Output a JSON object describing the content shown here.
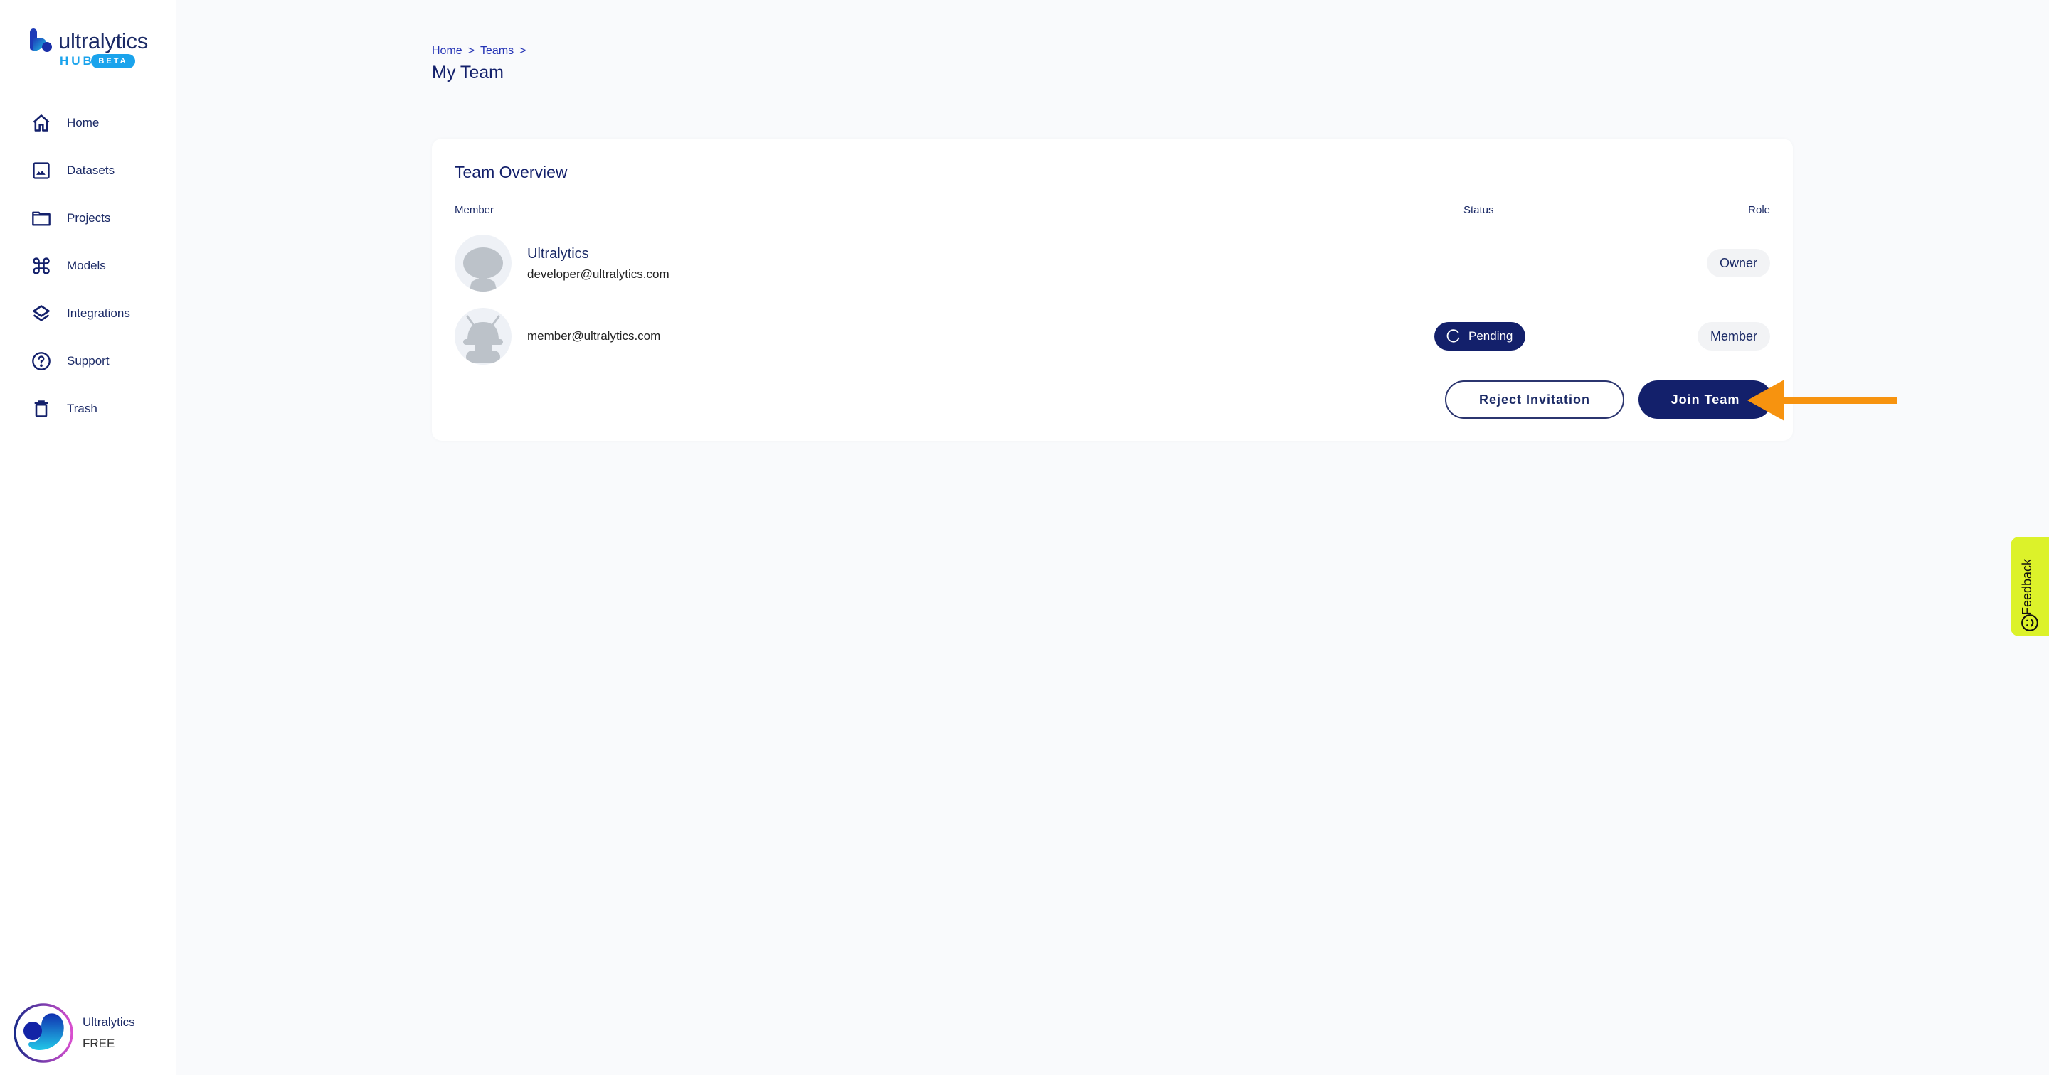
{
  "brand": {
    "wordmark": "ultralytics",
    "hub": "HUB",
    "beta": "BETA"
  },
  "sidebar": {
    "items": [
      {
        "label": "Home",
        "icon": "home-icon"
      },
      {
        "label": "Datasets",
        "icon": "image-icon"
      },
      {
        "label": "Projects",
        "icon": "folder-icon"
      },
      {
        "label": "Models",
        "icon": "command-icon"
      },
      {
        "label": "Integrations",
        "icon": "layers-icon"
      },
      {
        "label": "Support",
        "icon": "help-circle-icon"
      },
      {
        "label": "Trash",
        "icon": "trash-icon"
      }
    ],
    "account": {
      "name": "Ultralytics",
      "plan": "FREE"
    }
  },
  "breadcrumb": {
    "items": [
      "Home",
      "Teams"
    ],
    "separator": ">"
  },
  "page": {
    "title": "My Team"
  },
  "team_overview": {
    "title": "Team Overview",
    "columns": {
      "member": "Member",
      "status": "Status",
      "role": "Role"
    },
    "rows": [
      {
        "name": "Ultralytics",
        "email": "developer@ultralytics.com",
        "status": "",
        "role": "Owner"
      },
      {
        "name": "",
        "email": "member@ultralytics.com",
        "status": "Pending",
        "role": "Member"
      }
    ],
    "actions": {
      "reject": "Reject Invitation",
      "join": "Join Team"
    }
  },
  "feedback": {
    "label": "Feedback"
  },
  "colors": {
    "primary": "#13206b",
    "accent_blue": "#1aa3ec",
    "annotation_arrow": "#f7930f",
    "feedback_bg": "#dcf22a"
  }
}
